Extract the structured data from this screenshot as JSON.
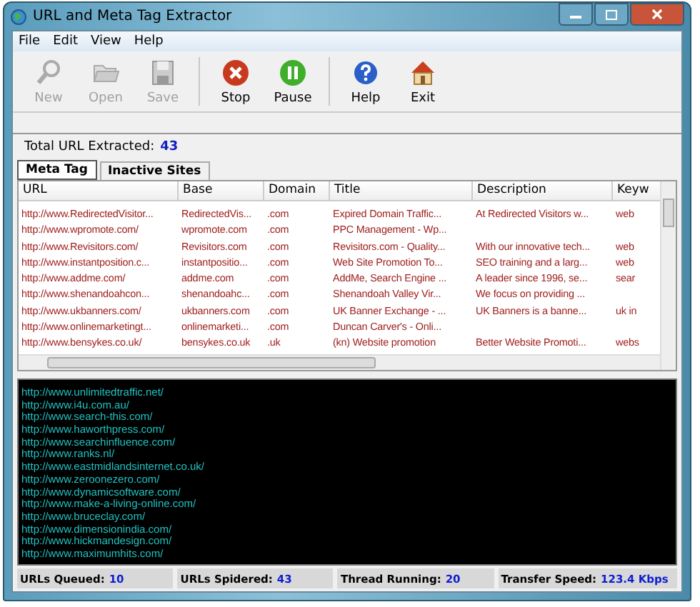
{
  "window": {
    "title": "URL and Meta Tag Extractor"
  },
  "menu": [
    "File",
    "Edit",
    "View",
    "Help"
  ],
  "toolbar": [
    {
      "kind": "new",
      "label": "New",
      "disabled": true
    },
    {
      "kind": "open",
      "label": "Open",
      "disabled": true
    },
    {
      "kind": "save",
      "label": "Save",
      "disabled": true
    },
    {
      "kind": "stop",
      "label": "Stop",
      "disabled": false
    },
    {
      "kind": "pause",
      "label": "Pause",
      "disabled": false
    },
    {
      "kind": "help",
      "label": "Help",
      "disabled": false
    },
    {
      "kind": "exit",
      "label": "Exit",
      "disabled": false
    }
  ],
  "total": {
    "label": "Total URL Extracted:",
    "value": "43"
  },
  "tabs": [
    {
      "label": "Meta Tag",
      "selected": true
    },
    {
      "label": "Inactive Sites",
      "selected": false
    }
  ],
  "table": {
    "columns": [
      "URL",
      "Base",
      "Domain",
      "Title",
      "Description",
      "Keyw"
    ],
    "rows": [
      [
        "http://www.RedirectedVisitor...",
        "RedirectedVis...",
        ".com",
        "Expired Domain Traffic...",
        "At Redirected Visitors w...",
        "web"
      ],
      [
        "http://www.wpromote.com/",
        "wpromote.com",
        ".com",
        "PPC Management - Wp...",
        "",
        ""
      ],
      [
        "http://www.Revisitors.com/",
        "Revisitors.com",
        ".com",
        "Revisitors.com - Quality...",
        "With our innovative tech...",
        "web"
      ],
      [
        "http://www.instantposition.c...",
        "instantpositio...",
        ".com",
        "Web Site Promotion To...",
        "SEO training and a larg...",
        "web"
      ],
      [
        "http://www.addme.com/",
        "addme.com",
        ".com",
        "AddMe, Search Engine ...",
        "A leader since 1996, se...",
        "sear"
      ],
      [
        "http://www.shenandoahcon...",
        "shenandoahc...",
        ".com",
        "Shenandoah Valley Vir...",
        "We focus on providing ...",
        ""
      ],
      [
        "http://www.ukbanners.com/",
        "ukbanners.com",
        ".com",
        "UK Banner Exchange - ...",
        "UK Banners is a banne...",
        "uk in"
      ],
      [
        "http://www.onlinemarketingt...",
        "onlinemarketi...",
        ".com",
        "Duncan Carver's - Onli...",
        "",
        ""
      ],
      [
        "http://www.bensykes.co.uk/",
        "bensykes.co.uk",
        ".uk",
        "(kn) Website promotion",
        "Better Website Promoti...",
        "webs"
      ]
    ]
  },
  "console": [
    "http://www.unlimitedtraffic.net/",
    "http://www.i4u.com.au/",
    "http://www.search-this.com/",
    "http://www.haworthpress.com/",
    "http://www.searchinfluence.com/",
    "http://www.ranks.nl/",
    "http://www.eastmidlandsinternet.co.uk/",
    "http://www.zeroonezero.com/",
    "http://www.dynamicsoftware.com/",
    "http://www.make-a-living-online.com/",
    "http://www.bruceclay.com/",
    "http://www.dimensionindia.com/",
    "http://www.hickmandesign.com/",
    "http://www.maximumhits.com/"
  ],
  "status_bar": [
    {
      "label": "URLs Queued:",
      "value": "10"
    },
    {
      "label": "URLs Spidered:",
      "value": "43"
    },
    {
      "label": "Thread Running:",
      "value": "20"
    },
    {
      "label": "Transfer Speed:",
      "value": "123.4 Kbps"
    }
  ]
}
